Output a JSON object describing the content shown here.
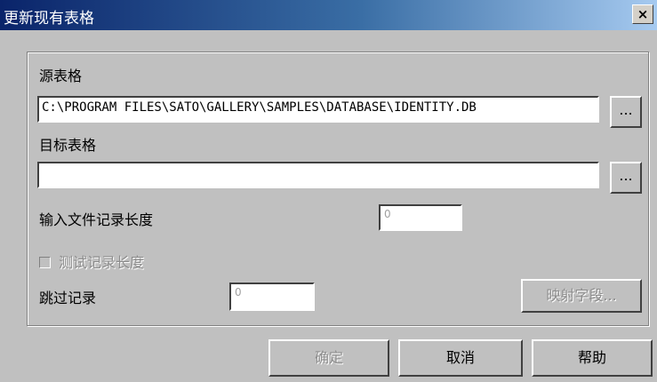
{
  "window": {
    "title": "更新现有表格",
    "close_label": "×"
  },
  "source": {
    "label": "源表格",
    "value": "C:\\PROGRAM FILES\\SATO\\GALLERY\\SAMPLES\\DATABASE\\IDENTITY.DB",
    "browse_label": "..."
  },
  "target": {
    "label": "目标表格",
    "value": "",
    "browse_label": "..."
  },
  "record_length": {
    "label": "输入文件记录长度",
    "placeholder": "0"
  },
  "test_length": {
    "label": "测试记录长度",
    "checked": false
  },
  "skip": {
    "label": "跳过记录",
    "placeholder": "0"
  },
  "map_button": {
    "label": "映射字段..."
  },
  "buttons": {
    "ok": "确定",
    "cancel": "取消",
    "help": "帮助"
  }
}
